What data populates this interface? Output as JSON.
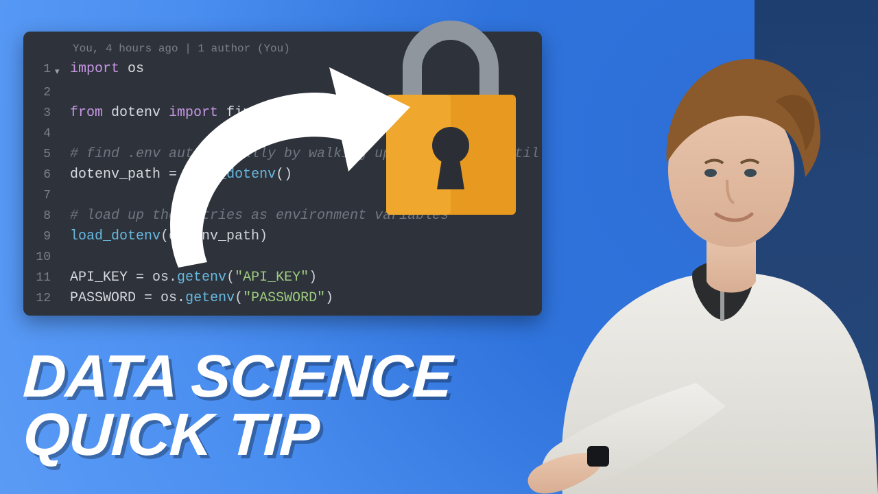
{
  "editor": {
    "blame": "You, 4 hours ago | 1 author (You)",
    "lines": {
      "n1": "1",
      "n2": "2",
      "n3": "3",
      "n4": "4",
      "n5": "5",
      "n6": "6",
      "n7": "7",
      "n8": "8",
      "n9": "9",
      "n10": "10",
      "n11": "11",
      "n12": "12"
    },
    "tok": {
      "l1_import": "import",
      "l1_os": " os",
      "l3_from": "from",
      "l3_dotenv": " dotenv ",
      "l3_import2": "import",
      "l3_rest": " find_dotenv, load_dotenv",
      "l5_cmt": "# find .env automatically by walking up directories until found",
      "l6_a": "dotenv_path ",
      "l6_eq": "=",
      "l6_b": " ",
      "l6_call": "find_dotenv",
      "l6_c": "()",
      "l8_cmt": "# load up the entries as environment variables",
      "l9_call": "load_dotenv",
      "l9_arg": "(dotenv_path)",
      "l11_a": "API_KEY ",
      "l11_eq": "=",
      "l11_b": " os.",
      "l11_call": "getenv",
      "l11_c": "(",
      "l11_str": "\"API_KEY\"",
      "l11_d": ")",
      "l12_a": "PASSWORD ",
      "l12_eq": "=",
      "l12_b": " os.",
      "l12_call": "getenv",
      "l12_c": "(",
      "l12_str": "\"PASSWORD\"",
      "l12_d": ")"
    }
  },
  "headline": {
    "line1": "DATA SCIENCE",
    "line2": "QUICK TIP"
  },
  "icons": {
    "arrow": "curved-arrow-icon",
    "lock": "lock-icon",
    "fold": "chevron-down-icon"
  },
  "colors": {
    "lock_body": "#e79a1f",
    "lock_shackle": "#8f969d",
    "lock_keyhole": "#2b2f35",
    "arrow_fill": "#ffffff",
    "editor_bg": "#2e333b"
  }
}
